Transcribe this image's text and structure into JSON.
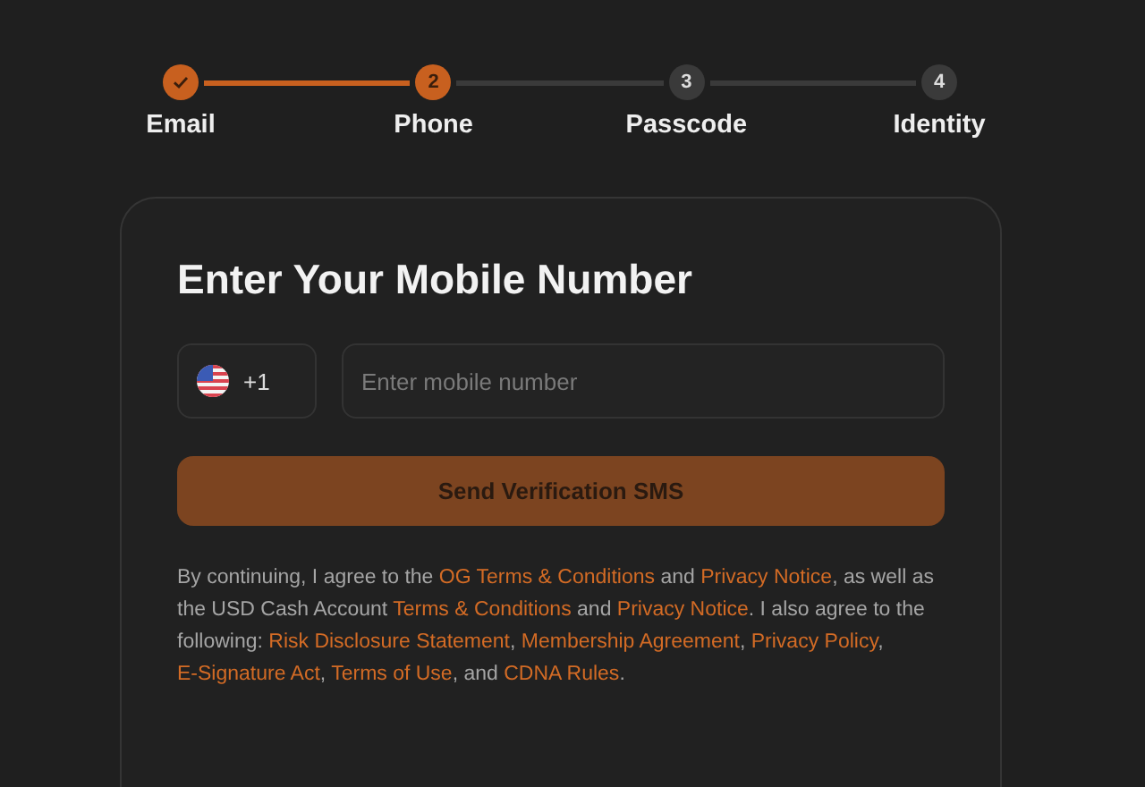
{
  "steps": [
    {
      "label": "Email",
      "completed": true,
      "selected": false
    },
    {
      "label": "Phone",
      "number": "2",
      "completed": false,
      "selected": true
    },
    {
      "label": "Passcode",
      "number": "3",
      "completed": false,
      "selected": false
    },
    {
      "label": "Identity",
      "number": "4",
      "completed": false,
      "selected": false
    }
  ],
  "card": {
    "title": "Enter Your Mobile Number",
    "country_code": "+1",
    "phone_placeholder": "Enter mobile number",
    "submit_label": "Send Verification SMS",
    "submit_disabled": true,
    "consent": [
      {
        "text": "By continuing, I agree to the ",
        "link": false
      },
      {
        "text": "OG Terms & Conditions",
        "link": true
      },
      {
        "text": " and ",
        "link": false
      },
      {
        "text": "Privacy Notice",
        "link": true
      },
      {
        "text": ", as well as the USD Cash Account ",
        "link": false
      },
      {
        "text": "Terms & Conditions",
        "link": true
      },
      {
        "text": " and ",
        "link": false
      },
      {
        "text": "Privacy Notice",
        "link": true
      },
      {
        "text": ". I also agree to the following: ",
        "link": false
      },
      {
        "text": "Risk Disclosure Statement",
        "link": true
      },
      {
        "text": ", ",
        "link": false
      },
      {
        "text": "Membership Agreement",
        "link": true
      },
      {
        "text": ", ",
        "link": false
      },
      {
        "text": "Privacy Policy",
        "link": true
      },
      {
        "text": ", ",
        "link": false
      },
      {
        "text": "E-Signature Act",
        "link": true
      },
      {
        "text": ", ",
        "link": false
      },
      {
        "text": "Terms of Use",
        "link": true
      },
      {
        "text": ", and ",
        "link": false
      },
      {
        "text": "CDNA Rules",
        "link": true
      },
      {
        "text": ".",
        "link": false
      }
    ]
  }
}
